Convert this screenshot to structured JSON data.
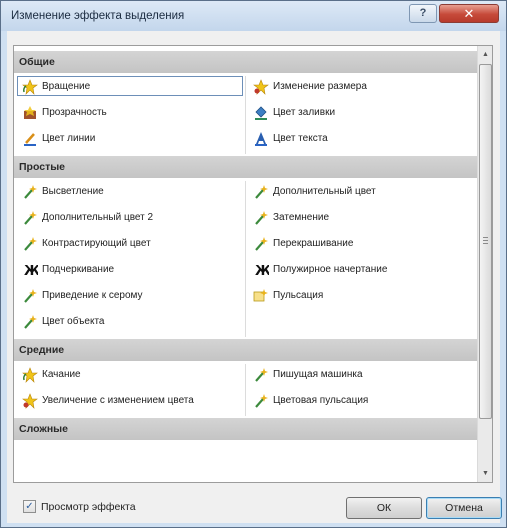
{
  "window": {
    "title": "Изменение эффекта выделения",
    "help_label": "?",
    "close_label": "✕"
  },
  "groups": [
    {
      "name": "Общие",
      "items": [
        {
          "label": "Вращение",
          "icon": "rotate-star-icon",
          "selected": true
        },
        {
          "label": "Изменение размера",
          "icon": "resize-star-icon"
        },
        {
          "label": "Прозрачность",
          "icon": "transparency-icon"
        },
        {
          "label": "Цвет заливки",
          "icon": "fill-bucket-icon"
        },
        {
          "label": "Цвет линии",
          "icon": "line-pen-icon"
        },
        {
          "label": "Цвет текста",
          "icon": "text-color-icon"
        }
      ]
    },
    {
      "name": "Простые",
      "items": [
        {
          "label": "Высветление",
          "icon": "wand-icon"
        },
        {
          "label": "Дополнительный цвет",
          "icon": "wand-icon"
        },
        {
          "label": "Дополнительный цвет 2",
          "icon": "wand-icon"
        },
        {
          "label": "Затемнение",
          "icon": "wand-icon"
        },
        {
          "label": "Контрастирующий цвет",
          "icon": "wand-icon"
        },
        {
          "label": "Перекрашивание",
          "icon": "wand-icon"
        },
        {
          "label": "Подчеркивание",
          "icon": "bold-icon"
        },
        {
          "label": "Полужирное начертание",
          "icon": "bold-icon"
        },
        {
          "label": "Приведение к серому",
          "icon": "wand-icon"
        },
        {
          "label": "Пульсация",
          "icon": "pulse-star-icon"
        },
        {
          "label": "Цвет объекта",
          "icon": "wand-icon"
        }
      ]
    },
    {
      "name": "Средние",
      "items": [
        {
          "label": "Качание",
          "icon": "rotate-star-icon"
        },
        {
          "label": "Пишущая машинка",
          "icon": "wand-icon"
        },
        {
          "label": "Увеличение с изменением цвета",
          "icon": "resize-star-icon"
        },
        {
          "label": "Цветовая пульсация",
          "icon": "wand-icon"
        }
      ]
    },
    {
      "name": "Сложные",
      "items": []
    }
  ],
  "preview": {
    "label": "Просмотр эффекта",
    "checked": true,
    "check_mark": "✓"
  },
  "buttons": {
    "ok": "ОК",
    "cancel": "Отмена"
  },
  "scrollbar": {
    "up": "▲",
    "down": "▼"
  },
  "colors": {
    "accent": "#6d8fb8",
    "close": "#c64a3a",
    "group_header": "#c8c8c8"
  }
}
